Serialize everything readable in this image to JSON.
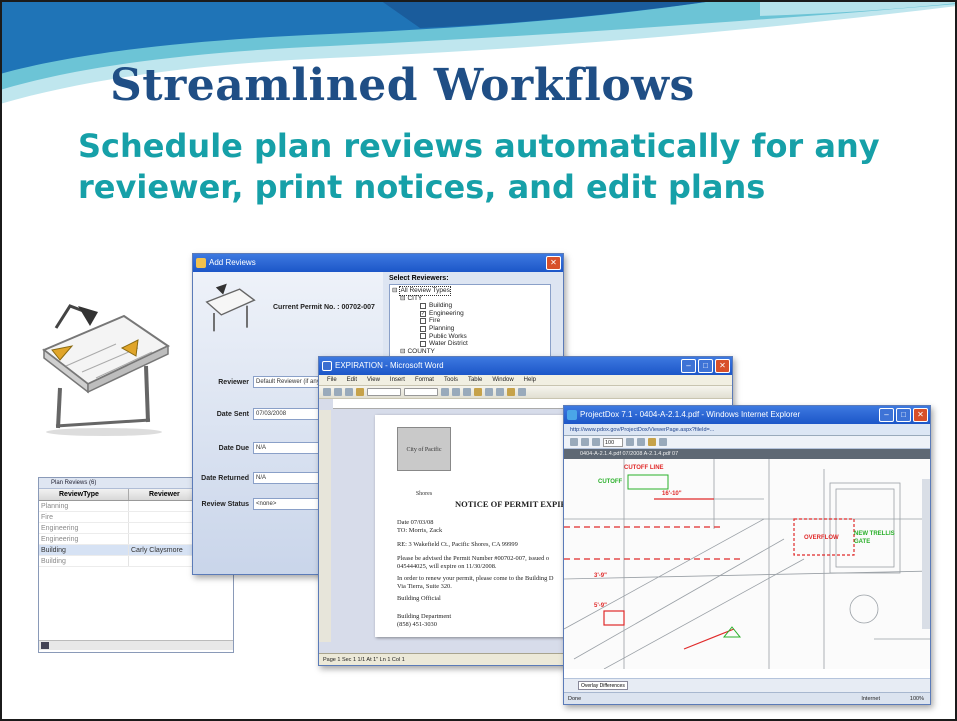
{
  "slide": {
    "title": "Streamlined  Workflows",
    "subtitle": "Schedule plan reviews automatically for any reviewer, print notices, and edit plans"
  },
  "add_reviews": {
    "title": "Add Reviews",
    "permit_label": "Current Permit No. : 00702-007",
    "select_label": "Select Reviewers:",
    "tree": [
      {
        "label": "All Review Types",
        "level": 0,
        "checkbox": false,
        "selected": true
      },
      {
        "label": "CITY",
        "level": 1,
        "checkbox": false
      },
      {
        "label": "Building",
        "level": 2,
        "checkbox": true,
        "checked": false
      },
      {
        "label": "Engineering",
        "level": 2,
        "checkbox": true,
        "checked": true
      },
      {
        "label": "Fire",
        "level": 2,
        "checkbox": true,
        "checked": false
      },
      {
        "label": "Planning",
        "level": 2,
        "checkbox": true,
        "checked": false
      },
      {
        "label": "Public Works",
        "level": 2,
        "checkbox": true,
        "checked": false
      },
      {
        "label": "Water District",
        "level": 2,
        "checkbox": true,
        "checked": false
      },
      {
        "label": "COUNTY",
        "level": 1,
        "checkbox": false
      }
    ],
    "fields": {
      "reviewer_label": "Reviewer",
      "reviewer_value": "Default Reviewer (if any)",
      "date_sent_label": "Date Sent",
      "date_sent_value": "07/03/2008",
      "date_due_label": "Date Due",
      "date_due_value": "N/A",
      "date_returned_label": "Date Returned",
      "date_returned_value": "N/A",
      "status_label": "Review Status",
      "status_value": "<none>"
    }
  },
  "plan_reviews": {
    "header": "Plan Reviews (6)",
    "columns": [
      "ReviewType",
      "Reviewer"
    ],
    "rows": [
      {
        "type": "Planning",
        "reviewer": "",
        "highlight": false
      },
      {
        "type": "Fire",
        "reviewer": "",
        "highlight": false
      },
      {
        "type": "Engineering",
        "reviewer": "",
        "highlight": false
      },
      {
        "type": "Engineering",
        "reviewer": "",
        "highlight": false
      },
      {
        "type": "Building",
        "reviewer": "Carly Claysmore",
        "highlight": true
      },
      {
        "type": "Building",
        "reviewer": "",
        "highlight": false
      }
    ]
  },
  "word": {
    "title": "EXPIRATION - Microsoft Word",
    "menus": [
      "File",
      "Edit",
      "View",
      "Insert",
      "Format",
      "Tools",
      "Table",
      "Window",
      "Help"
    ],
    "logo_text": "City of Pacific Shores",
    "notice_title": "NOTICE OF PERMIT EXPIRA",
    "lines": [
      "Date   07/03/08",
      "TO:    Morris, Zack",
      "RE:    3 Wakefield Ct., Pacific Shores, CA  99999",
      "Please be advised the Permit Number #00702-007, issued o",
      "045444025, will expire on 11/30/2008.",
      "In order to renew your permit, please come to the Building D",
      "Via Tierra, Suite 320.",
      "Building Official",
      "Building Department",
      "(858) 451-3030"
    ],
    "status": "Page 1    Sec 1    1/1    At 1\"    Ln 1    Col 1"
  },
  "ie": {
    "title": "ProjectDox 7.1 - 0404-A-2.1.4.pdf - Windows Internet Explorer",
    "address": "http://www.pdox.gov/ProjectDox/ViewerPage.aspx?fileId=...",
    "zoom": "100",
    "tab": "0404-A-2.1.4.pdf 07/2008 A-2.1.4.pdf 07",
    "overlay": "Overlay Differences",
    "status_left": "Done",
    "status_mid": "Internet",
    "status_right": "100%"
  }
}
